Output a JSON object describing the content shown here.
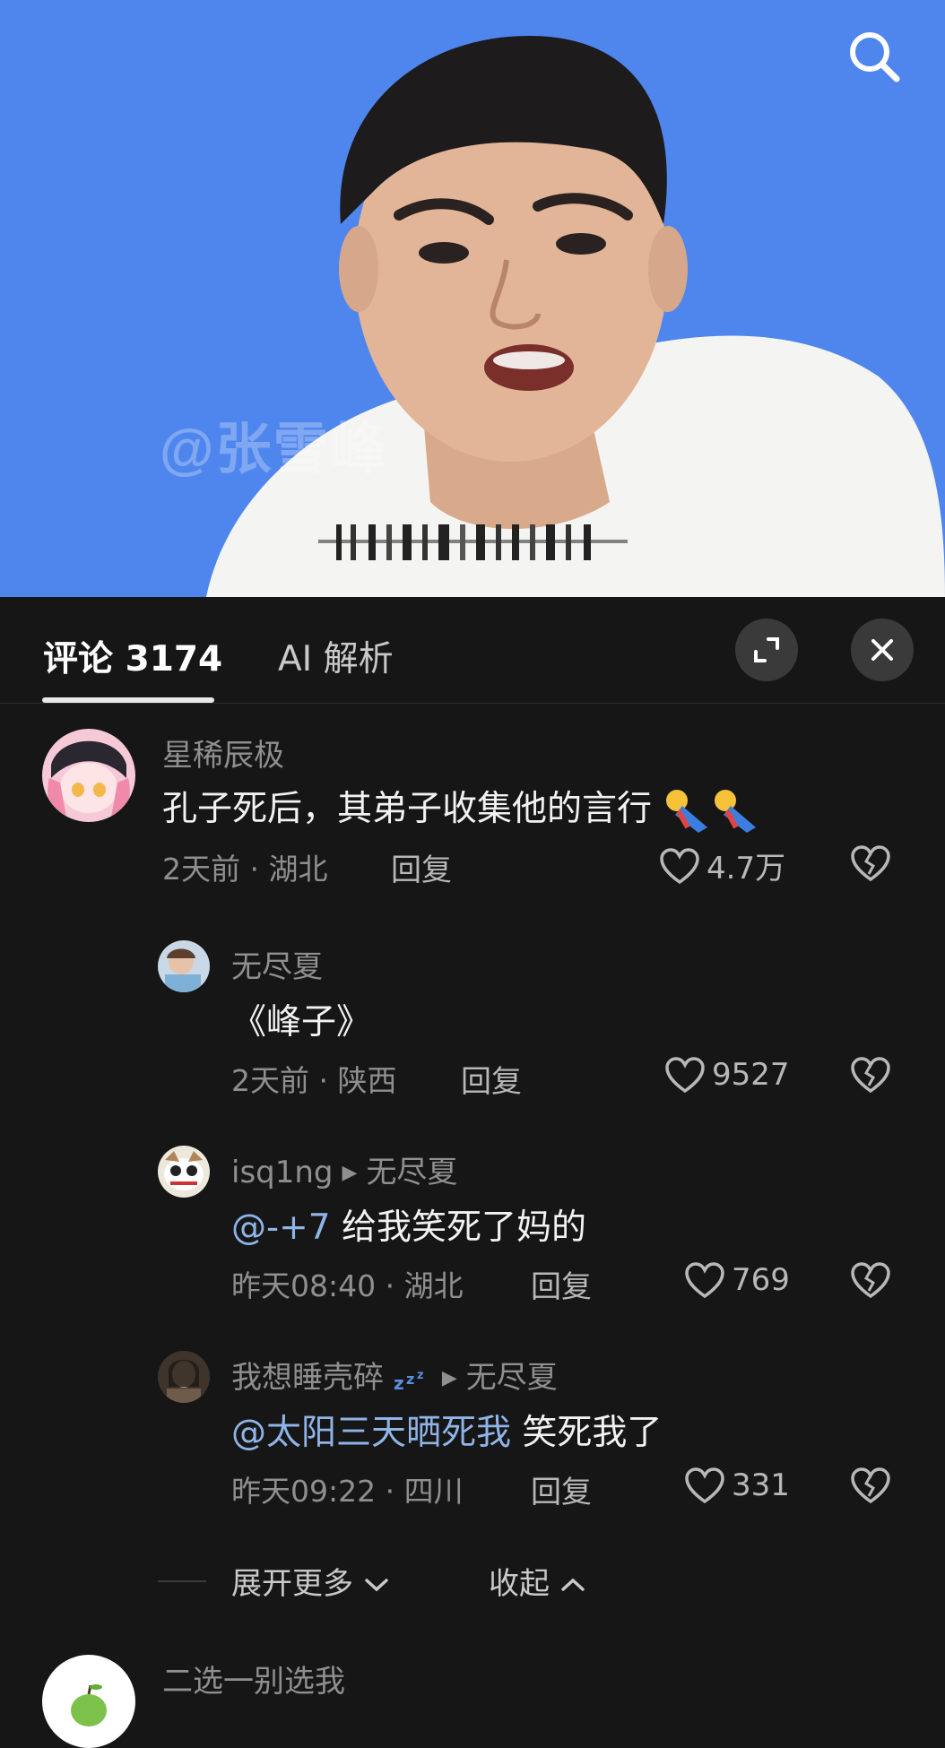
{
  "video": {
    "watermark": "@张雪峰"
  },
  "tabs": {
    "comments_label": "评论 3174",
    "ai_label": "AI 解析"
  },
  "comments": [
    {
      "author": "星稀辰极",
      "text": "孔子死后，其弟子收集他的言行",
      "time": "2天前 · 湖北",
      "reply_label": "回复",
      "likes": "4.7万"
    },
    {
      "author": "无尽夏",
      "text": "《峰子》",
      "time": "2天前 · 陕西",
      "reply_label": "回复",
      "likes": "9527"
    },
    {
      "author": "isq1ng",
      "reply_to": "无尽夏",
      "mention": "@-+7",
      "text": "给我笑死了妈的",
      "time": "昨天08:40 · 湖北",
      "reply_label": "回复",
      "likes": "769"
    },
    {
      "author": "我想睡壳碎",
      "reply_to": "无尽夏",
      "mention": "@太阳三天晒死我",
      "text": "笑死我了",
      "time": "昨天09:22 · 四川",
      "reply_label": "回复",
      "likes": "331"
    },
    {
      "author": "二选一别选我"
    }
  ],
  "thread_controls": {
    "expand_more": "展开更多",
    "collapse": "收起"
  },
  "colors": {
    "video_bg": "#4f86ee",
    "sheet_bg": "#161616",
    "mention": "#8fb4e8",
    "meta_text": "#8f8f8f"
  }
}
